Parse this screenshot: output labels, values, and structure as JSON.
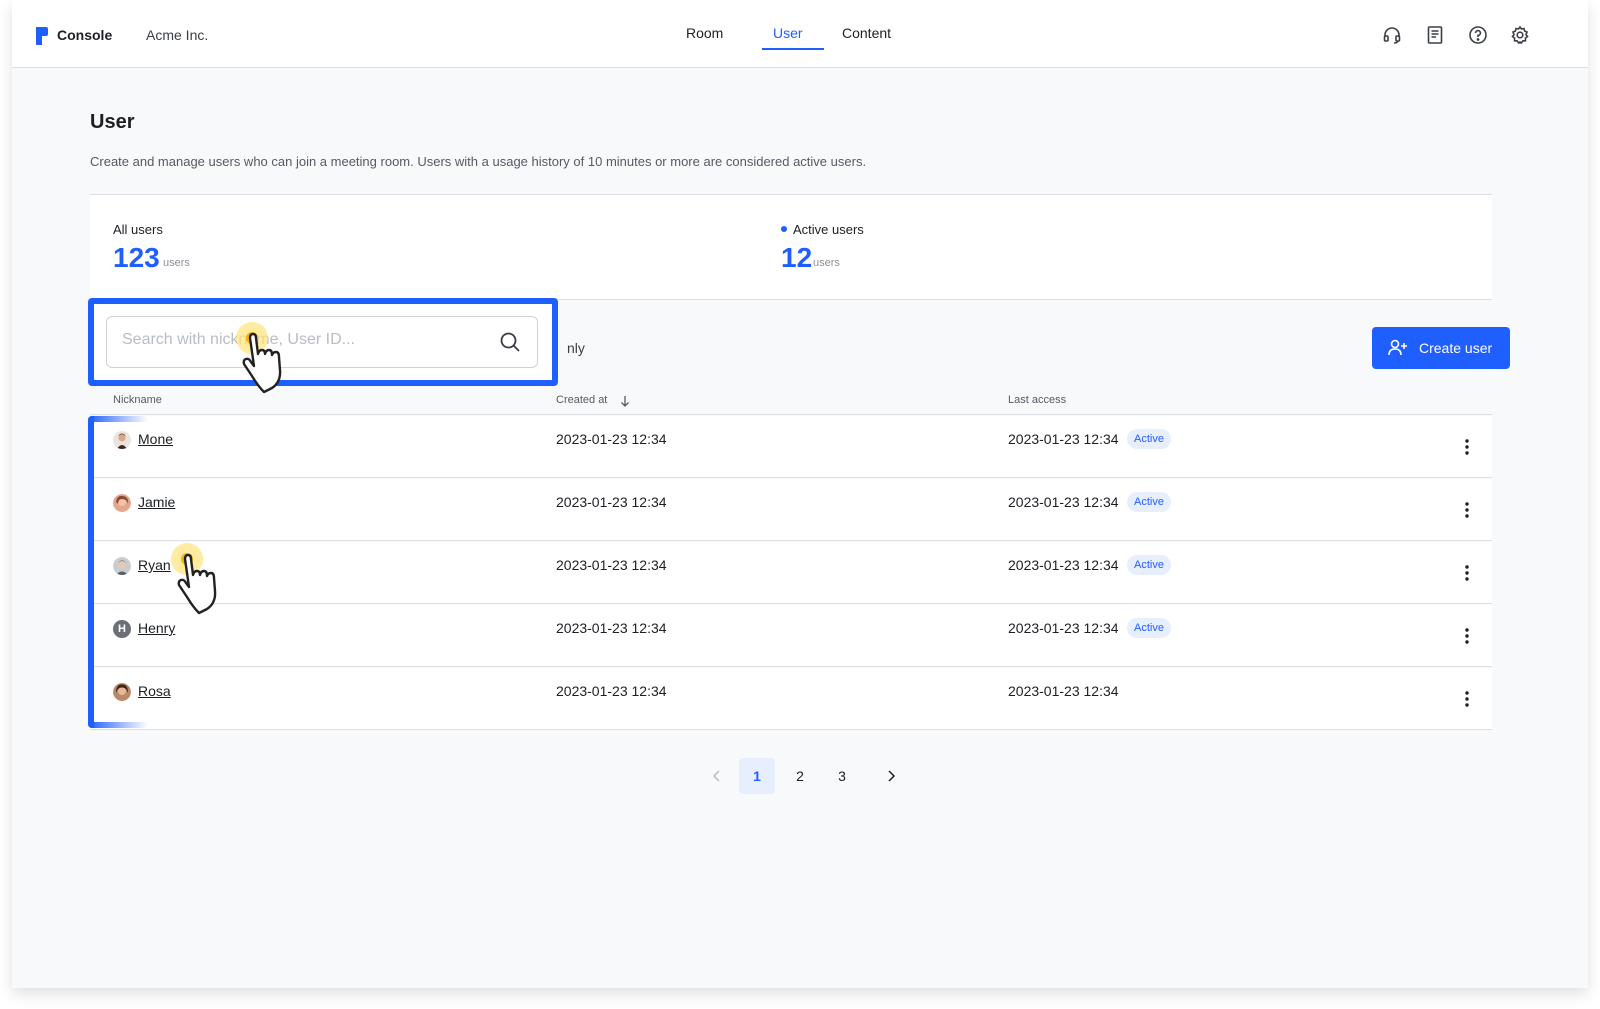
{
  "header": {
    "brand": "Console",
    "org": "Acme Inc.",
    "tabs": [
      {
        "label": "Room",
        "active": false
      },
      {
        "label": "User",
        "active": true
      },
      {
        "label": "Content",
        "active": false
      }
    ],
    "icons": [
      "headset-icon",
      "document-icon",
      "help-icon",
      "settings-icon"
    ]
  },
  "page": {
    "title": "User",
    "description": "Create and manage users who can join a meeting room. Users with a usage history of 10 minutes or more are considered active users."
  },
  "stats": {
    "all": {
      "label": "All users",
      "value": "123",
      "unit": "users"
    },
    "active": {
      "label": "Active users",
      "value": "12",
      "unit": "users"
    }
  },
  "search": {
    "placeholder": "Search with nickname, User ID...",
    "value": "",
    "trailing_text": "nly"
  },
  "create_button": {
    "label": "Create user"
  },
  "table": {
    "columns": {
      "nickname": "Nickname",
      "created": "Created at",
      "last": "Last access"
    },
    "rows": [
      {
        "nickname": "Mone",
        "created": "2023-01-23 12:34",
        "last": "2023-01-23 12:34",
        "status": "Active",
        "avatar": "photo"
      },
      {
        "nickname": "Jamie",
        "created": "2023-01-23 12:34",
        "last": "2023-01-23 12:34",
        "status": "Active",
        "avatar": "photo"
      },
      {
        "nickname": "Ryan",
        "created": "2023-01-23 12:34",
        "last": "2023-01-23 12:34",
        "status": "Active",
        "avatar": "photo"
      },
      {
        "nickname": "Henry",
        "created": "2023-01-23 12:34",
        "last": "2023-01-23 12:34",
        "status": "Active",
        "avatar": "H"
      },
      {
        "nickname": "Rosa",
        "created": "2023-01-23 12:34",
        "last": "2023-01-23 12:34",
        "status": "",
        "avatar": "photo"
      }
    ]
  },
  "pagination": {
    "pages": [
      "1",
      "2",
      "3"
    ],
    "current": "1"
  },
  "colors": {
    "accent": "#1f5eff",
    "badge_bg": "#e7efff",
    "border": "#dcdfe3"
  }
}
